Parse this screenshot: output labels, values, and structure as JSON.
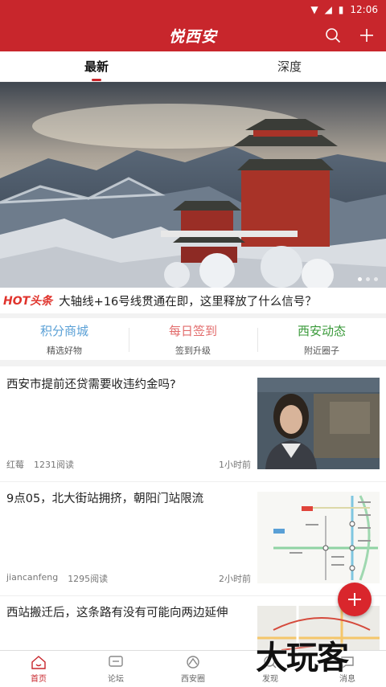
{
  "status_bar": {
    "time": "12:06"
  },
  "header": {
    "title": "悦西安"
  },
  "tabs": [
    {
      "label": "最新",
      "active": true
    },
    {
      "label": "深度",
      "active": false
    }
  ],
  "headline": {
    "badge": "HOT头条",
    "text": "大轴线+16号线贯通在即，这里释放了什么信号？"
  },
  "quick_entries": [
    {
      "title": "积分商城",
      "subtitle": "精选好物",
      "color": "#5aa0d6"
    },
    {
      "title": "每日签到",
      "subtitle": "签到升级",
      "color": "#e26b6b"
    },
    {
      "title": "西安动态",
      "subtitle": "附近圈子",
      "color": "#3a9a3a"
    }
  ],
  "feed": [
    {
      "title": "西安市提前还贷需要收违约金吗?",
      "author": "红莓",
      "reads": "1231阅读",
      "time": "1小时前"
    },
    {
      "title": "9点05，北大街站拥挤，朝阳门站限流",
      "author": "jiancanfeng",
      "reads": "1295阅读",
      "time": "2小时前"
    },
    {
      "title": "西站搬迁后，这条路有没有可能向两边延伸"
    }
  ],
  "bottom_nav": [
    {
      "label": "首页",
      "icon": "home-icon",
      "active": true
    },
    {
      "label": "论坛",
      "icon": "forum-icon",
      "active": false
    },
    {
      "label": "西安圈",
      "icon": "circle-icon",
      "active": false
    },
    {
      "label": "发现",
      "icon": "discover-icon",
      "active": false
    },
    {
      "label": "消息",
      "icon": "message-icon",
      "active": false
    }
  ],
  "watermark": "大玩客",
  "colors": {
    "brand": "#c8262c"
  }
}
